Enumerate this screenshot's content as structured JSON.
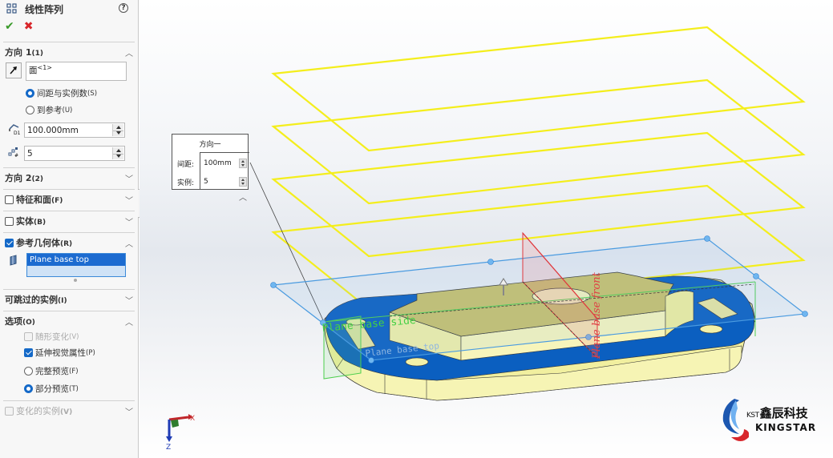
{
  "panel": {
    "title": "线性阵列",
    "help_icon": "question-circle-icon",
    "ok_icon": "checkmark-icon",
    "cancel_icon": "x-icon",
    "direction1": {
      "label": "方向 1",
      "suffix": "(1)",
      "face_value": "面",
      "face_suffix": "<1>",
      "spacing_radio": "间距与实例数",
      "spacing_radio_key": "(S)",
      "to_ref_radio": "到参考",
      "to_ref_key": "(U)",
      "spacing_selected": true,
      "spacing_value": "100.000mm",
      "instances_value": "5"
    },
    "direction2": {
      "label": "方向 2",
      "suffix": "(2)"
    },
    "features_faces": {
      "label": "特征和面",
      "key": "(F)",
      "checked": false
    },
    "bodies": {
      "label": "实体",
      "key": "(B)",
      "checked": false
    },
    "ref_geometry": {
      "label": "参考几何体",
      "key": "(R)",
      "checked": true,
      "selection": "Plane base top"
    },
    "skip_instances": {
      "label": "可跳过的实例",
      "key": "(I)"
    },
    "options": {
      "label": "选项",
      "key": "(O)",
      "items": [
        {
          "label": "随形变化",
          "key": "(V)",
          "type": "checkbox",
          "checked": false,
          "disabled": true
        },
        {
          "label": "延伸视觉属性",
          "key": "(P)",
          "type": "checkbox",
          "checked": true,
          "disabled": false
        },
        {
          "label": "完整预览",
          "key": "(F)",
          "type": "radio",
          "checked": false,
          "disabled": false
        },
        {
          "label": "部分预览",
          "key": "(T)",
          "type": "radio",
          "checked": true,
          "disabled": false
        }
      ]
    },
    "varying_instances": {
      "label": "变化的实例",
      "key": "(V)",
      "checked": false,
      "disabled": true
    }
  },
  "callout": {
    "title": "方向一",
    "spacing_label": "间距:",
    "spacing_value": "100mm",
    "instances_label": "实例:",
    "instances_value": "5"
  },
  "viewport": {
    "plane_labels": {
      "side": "Plane base side",
      "top": "Plane base top",
      "front": "Plane base front"
    },
    "pattern_instances": 5,
    "colors": {
      "preview_plane": "#f4ee1c",
      "selected_plane": "#4a9be0",
      "side_plane": "#4ccf4c",
      "front_plane": "#e0393e",
      "part_face": "#f4f2a8",
      "part_selected_face": "#0a5fbf"
    },
    "triad": {
      "x": "X",
      "z": "Z"
    }
  },
  "logo": {
    "prefix": "KST",
    "name_cn": "鑫辰科技",
    "name_en": "KINGSTAR"
  }
}
